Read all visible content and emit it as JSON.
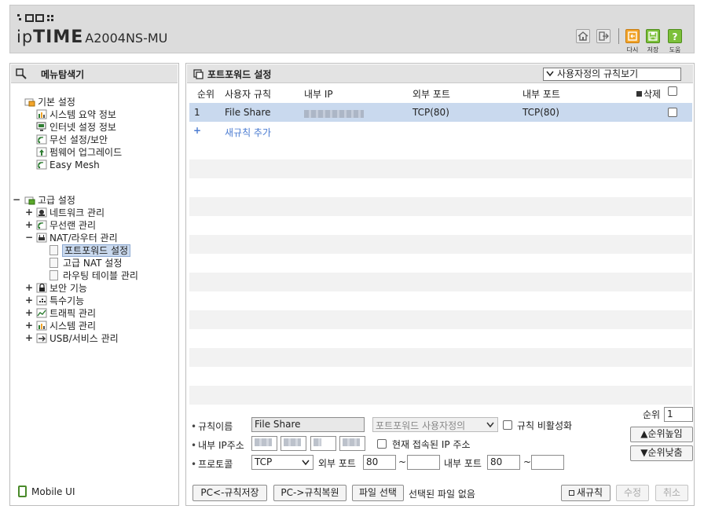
{
  "header": {
    "brand_ip": "ip",
    "brand_time": "TIME",
    "model": "A2004NS-MU",
    "buttons": [
      {
        "label": "",
        "icon": "home-icon"
      },
      {
        "label": "",
        "icon": "logout-icon"
      },
      {
        "label": "다시",
        "icon": "reload-icon"
      },
      {
        "label": "저장",
        "icon": "save-icon"
      },
      {
        "label": "도움",
        "icon": "help-icon"
      }
    ]
  },
  "sidebar": {
    "title": "메뉴탐색기",
    "basic": {
      "label": "기본 설정",
      "items": [
        "시스템 요약 정보",
        "인터넷 설정 정보",
        "무선 설정/보안",
        "펌웨어 업그레이드",
        "Easy Mesh"
      ]
    },
    "advanced": {
      "label": "고급 설정",
      "items": [
        "네트워크 관리",
        "무선랜 관리",
        "NAT/라우터 관리",
        "보안 기능",
        "특수기능",
        "트래픽 관리",
        "시스템 관리",
        "USB/서비스 관리"
      ],
      "nat_children": [
        "포트포워드 설정",
        "고급 NAT 설정",
        "라우팅 테이블 관리"
      ]
    },
    "mobile_ui": "Mobile UI"
  },
  "main": {
    "title": "포트포워드 설정",
    "rule_view_select": "사용자정의 규칙보기",
    "columns": [
      "순위",
      "사용자 규칙",
      "내부 IP",
      "외부 포트",
      "내부 포트",
      "삭제"
    ],
    "rows": [
      {
        "rank": "1",
        "name": "File Share",
        "internal_ip": "",
        "external_port": "TCP(80)",
        "internal_port": "TCP(80)"
      }
    ],
    "add_rule": "새규칙 추가",
    "add_rule_plus": "+"
  },
  "form": {
    "rule_name_label": "규칙이름",
    "rule_name_value": "File Share",
    "preset_select": "포트포워드 사용자정의",
    "disable_label": "규칙 비활성화",
    "internal_ip_label": "내부 IP주소",
    "current_ip_label": "현재 접속된 IP 주소",
    "protocol_label": "프로토콜",
    "protocol_value": "TCP",
    "external_port_label": "외부 포트",
    "external_port_from": "80",
    "external_port_to": "",
    "internal_port_label": "내부 포트",
    "internal_port_from": "80",
    "internal_port_to": "",
    "tilde": "~",
    "rank_label": "순위",
    "rank_value": "1",
    "rank_up": "▲순위높임",
    "rank_down": "▼순위낮춤"
  },
  "footer": {
    "save_to_pc": "PC<-규칙저장",
    "restore_from_pc": "PC->규칙복원",
    "choose_file": "파일 선택",
    "no_file": "선택된 파일 없음",
    "new_rule": "새규칙",
    "edit": "수정",
    "cancel": "취소"
  }
}
